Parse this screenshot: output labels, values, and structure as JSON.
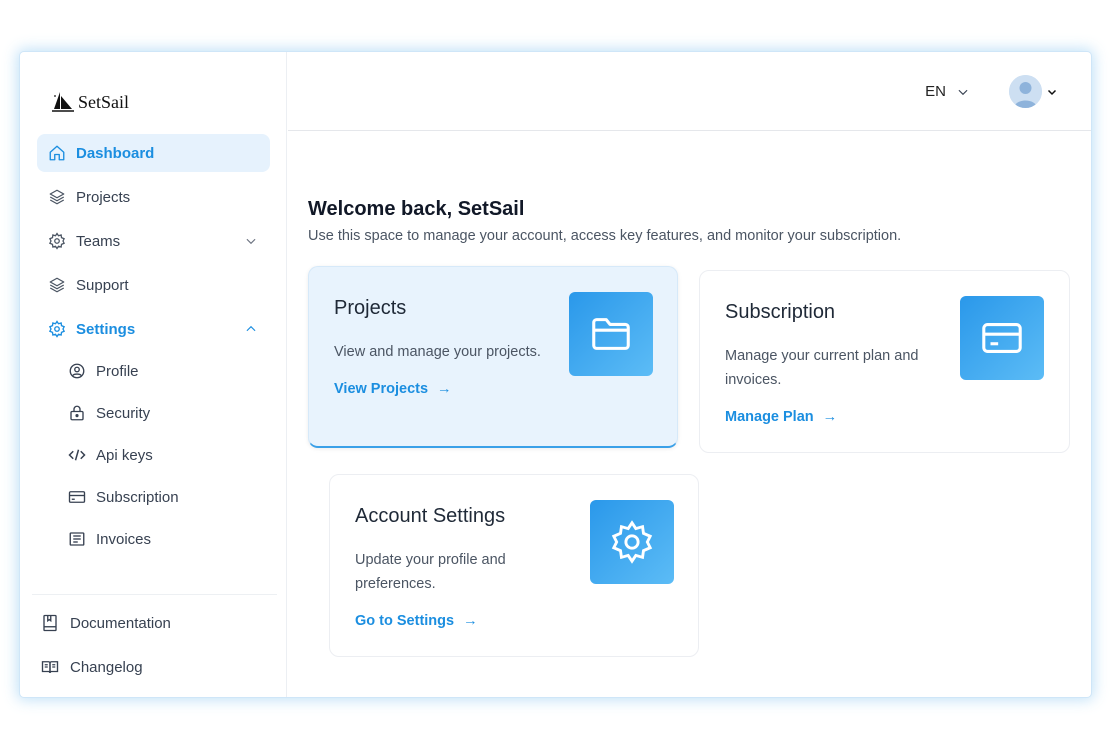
{
  "brand": {
    "name": "SetSail"
  },
  "sidebar": {
    "items": [
      {
        "label": "Dashboard",
        "icon": "home-icon"
      },
      {
        "label": "Projects",
        "icon": "layers-icon"
      },
      {
        "label": "Teams",
        "icon": "gear-icon"
      },
      {
        "label": "Support",
        "icon": "layers-icon"
      },
      {
        "label": "Settings",
        "icon": "gear-icon"
      }
    ],
    "settings_sub": [
      {
        "label": "Profile",
        "icon": "user-circle-icon"
      },
      {
        "label": "Security",
        "icon": "lock-icon"
      },
      {
        "label": "Api keys",
        "icon": "code-icon"
      },
      {
        "label": "Subscription",
        "icon": "card-icon"
      },
      {
        "label": "Invoices",
        "icon": "invoice-icon"
      }
    ],
    "footer": [
      {
        "label": "Documentation",
        "icon": "book-icon"
      },
      {
        "label": "Changelog",
        "icon": "open-book-icon"
      }
    ]
  },
  "topbar": {
    "language": "EN"
  },
  "main": {
    "title": "Welcome back, SetSail",
    "subtitle": "Use this space to manage your account, access key features, and monitor your subscription.",
    "cards": {
      "projects": {
        "title": "Projects",
        "desc": "View and manage your projects.",
        "link": "View Projects",
        "icon": "folder-icon"
      },
      "subscription": {
        "title": "Subscription",
        "desc_line1": "Manage your current plan and",
        "desc_line2": "invoices.",
        "link": "Manage Plan",
        "icon": "credit-card-icon"
      },
      "account": {
        "title": "Account Settings",
        "desc_line1": "Update your profile and",
        "desc_line2": "preferences.",
        "link": "Go to Settings",
        "icon": "gear-icon"
      }
    },
    "arrow": "→"
  },
  "colors": {
    "accent": "#1b8ee0",
    "active_bg": "#e6f2fd",
    "highlight_card": "#e8f3fd"
  }
}
